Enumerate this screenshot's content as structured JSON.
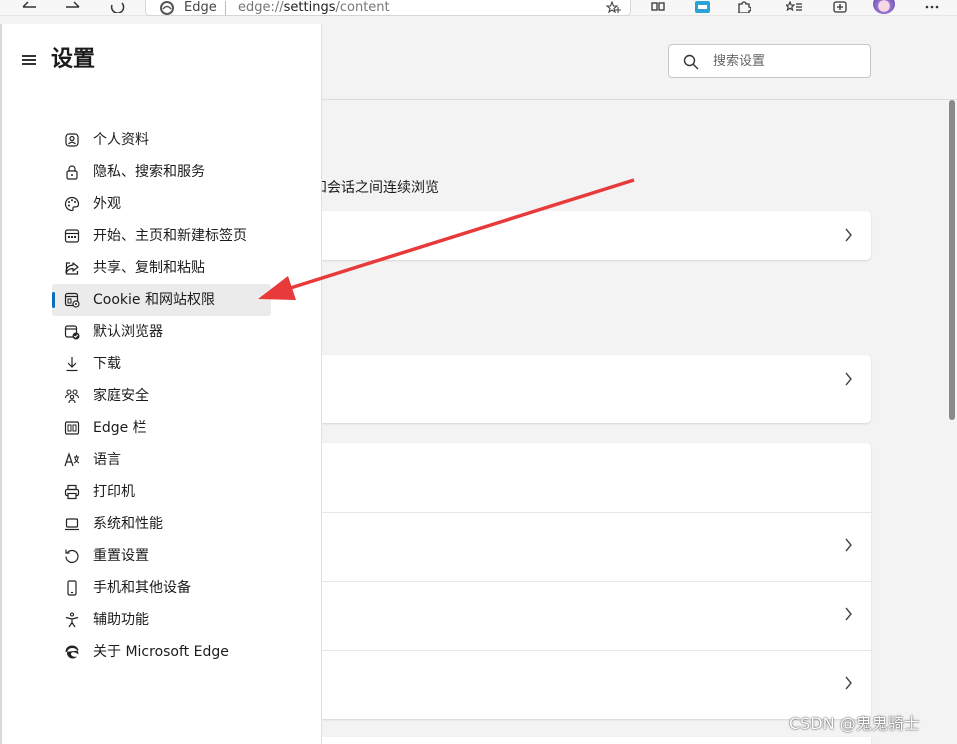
{
  "browser": {
    "site_label": "Edge",
    "url_prefix": "edge://",
    "url_page": "settings",
    "url_suffix": "/content"
  },
  "sidebar": {
    "title": "设置",
    "items": [
      {
        "label": "个人资料",
        "icon": "profile-icon"
      },
      {
        "label": "隐私、搜索和服务",
        "icon": "lock-icon"
      },
      {
        "label": "外观",
        "icon": "palette-icon"
      },
      {
        "label": "开始、主页和新建标签页",
        "icon": "start-page-icon"
      },
      {
        "label": "共享、复制和粘贴",
        "icon": "share-icon"
      },
      {
        "label": "Cookie 和网站权限",
        "icon": "cookie-site-permissions-icon",
        "active": true
      },
      {
        "label": "默认浏览器",
        "icon": "default-browser-icon"
      },
      {
        "label": "下载",
        "icon": "download-icon"
      },
      {
        "label": "家庭安全",
        "icon": "family-icon"
      },
      {
        "label": "Edge 栏",
        "icon": "edge-bar-icon"
      },
      {
        "label": "语言",
        "icon": "language-icon"
      },
      {
        "label": "打印机",
        "icon": "printer-icon"
      },
      {
        "label": "系统和性能",
        "icon": "laptop-icon"
      },
      {
        "label": "重置设置",
        "icon": "reset-icon"
      },
      {
        "label": "手机和其他设备",
        "icon": "phone-icon"
      },
      {
        "label": "辅助功能",
        "icon": "accessibility-icon"
      },
      {
        "label": "关于 Microsoft Edge",
        "icon": "edge-logo-icon"
      }
    ]
  },
  "search": {
    "placeholder": "搜索设置"
  },
  "main": {
    "fragment_text": "和会话之间连续浏览"
  },
  "colors": {
    "accent": "#0f6cbd",
    "annotation_arrow": "#e83a3a"
  },
  "watermark": "CSDN @鬼鬼骑士"
}
